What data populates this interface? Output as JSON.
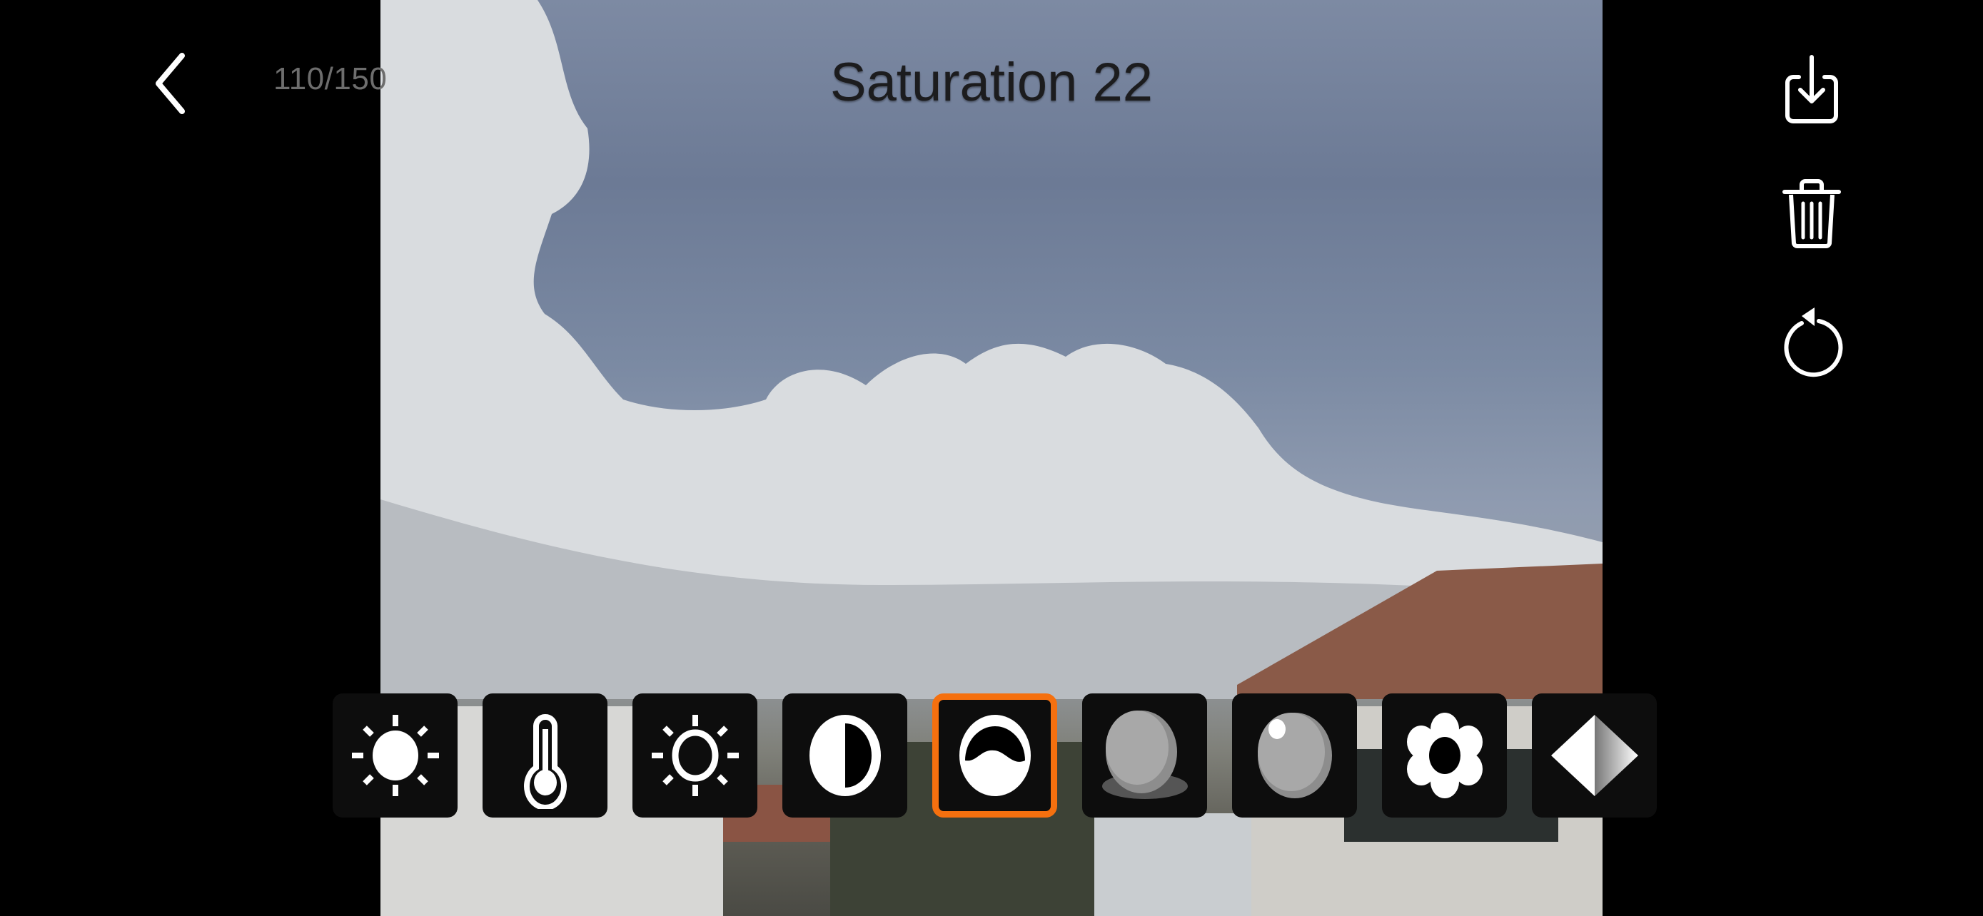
{
  "header": {
    "title": "Saturation 22",
    "counter": "110/150"
  },
  "navigation": {
    "back_icon": "chevron-left-icon"
  },
  "side_actions": [
    {
      "name": "save",
      "icon": "save-download-icon"
    },
    {
      "name": "delete",
      "icon": "trash-icon"
    },
    {
      "name": "reset",
      "icon": "rotate-reset-icon"
    }
  ],
  "toolbar": {
    "selected_index": 4,
    "accent_color": "#f5700f",
    "tools": [
      {
        "name": "brightness",
        "icon": "sun-filled-icon"
      },
      {
        "name": "temperature",
        "icon": "thermometer-icon"
      },
      {
        "name": "exposure",
        "icon": "sun-outline-icon"
      },
      {
        "name": "contrast",
        "icon": "half-circle-icon"
      },
      {
        "name": "saturation",
        "icon": "wave-circle-icon"
      },
      {
        "name": "shadows",
        "icon": "sphere-shadow-icon"
      },
      {
        "name": "highlights",
        "icon": "sphere-highlight-icon"
      },
      {
        "name": "vibrance",
        "icon": "flower-icon"
      },
      {
        "name": "sharpness",
        "icon": "diamond-gradient-icon"
      }
    ]
  }
}
